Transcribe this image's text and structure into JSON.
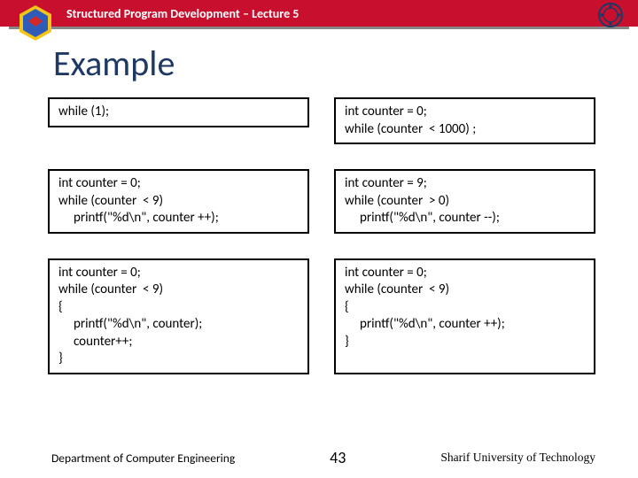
{
  "header": {
    "title": "Structured Program Development – Lecture 5"
  },
  "slide": {
    "heading": "Example",
    "boxes": [
      "while (1);",
      "int counter = 0;\nwhile (counter  < 1000) ;",
      "int counter = 0;\nwhile (counter  < 9)\n     printf(\"%d\\n\", counter ++);",
      "int counter = 9;\nwhile (counter  > 0)\n     printf(\"%d\\n\", counter --);",
      "int counter = 0;\nwhile (counter  < 9)\n{\n     printf(\"%d\\n\", counter);\n     counter++;\n}",
      "int counter = 0;\nwhile (counter  < 9)\n{\n     printf(\"%d\\n\", counter ++);\n}"
    ]
  },
  "footer": {
    "left": "Department of Computer Engineering",
    "page": "43",
    "right": "Sharif University of Technology"
  }
}
